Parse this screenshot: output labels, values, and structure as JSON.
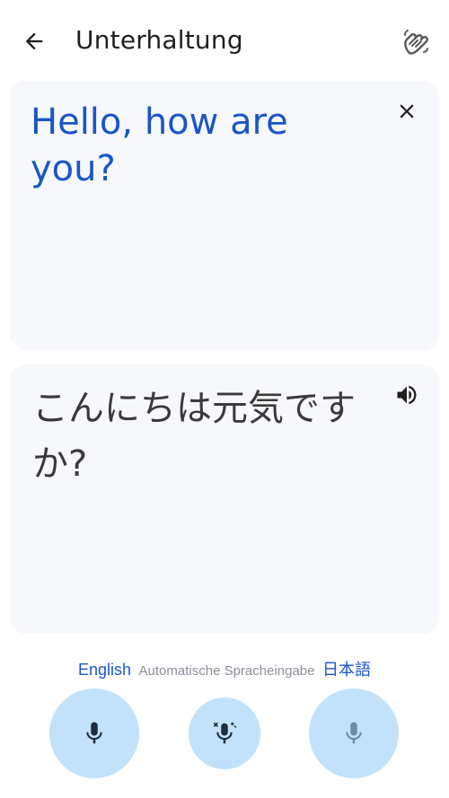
{
  "header": {
    "title": "Unterhaltung",
    "back_icon": "arrow-back-icon",
    "wave_icon": "waving-hand-icon"
  },
  "source_card": {
    "text": "Hello, how are you?",
    "clear_icon": "close-icon"
  },
  "target_card": {
    "text": "こんにちは元気ですか?",
    "speaker_icon": "volume-up-icon"
  },
  "languages": {
    "left": "English",
    "middle": "Automatische Spracheingabe",
    "right": "日本語"
  },
  "mic_buttons": {
    "left_icon": "mic-icon",
    "auto_icon": "mic-auto-icon",
    "right_icon": "mic-icon"
  },
  "colors": {
    "accent": "#1a56c8",
    "card_bg": "#f6f8fc",
    "mic_bg": "#c2e2fb",
    "mic_icon_active": "#1f2d3d",
    "mic_icon_inactive": "#6b8aa6"
  }
}
